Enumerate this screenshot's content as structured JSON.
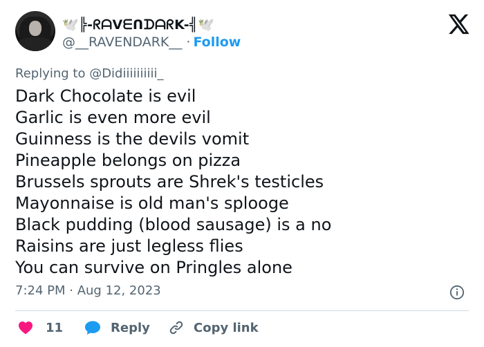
{
  "user": {
    "display_name": "🕊️╠-ᖇᗩᐯᗴᑎᗪᗩᖇK-╣🕊️",
    "handle": "@__RAVENDARK__",
    "separator": "·",
    "follow_label": "Follow"
  },
  "reply_to": "Replying to @Didiiiiiiiiii_",
  "tweet_lines": [
    "Dark Chocolate is evil",
    "Garlic is even more evil",
    "Guinness is the devils vomit",
    "Pineapple belongs on pizza",
    "Brussels sprouts are Shrek's testicles",
    "Mayonnaise is old man's splooge",
    "Black pudding (blood sausage) is a no",
    "Raisins are just legless flies",
    "You can survive on Pringles alone"
  ],
  "timestamp": "7:24 PM · Aug 12, 2023",
  "actions": {
    "like_count": "11",
    "reply_label": "Reply",
    "copy_link_label": "Copy link"
  },
  "colors": {
    "accent": "#1d9bf0",
    "like": "#f91880",
    "muted": "#536471",
    "text": "#0f1419"
  },
  "icons": [
    "x-logo-icon",
    "info-icon",
    "heart-icon",
    "reply-bubble-icon",
    "link-icon"
  ]
}
